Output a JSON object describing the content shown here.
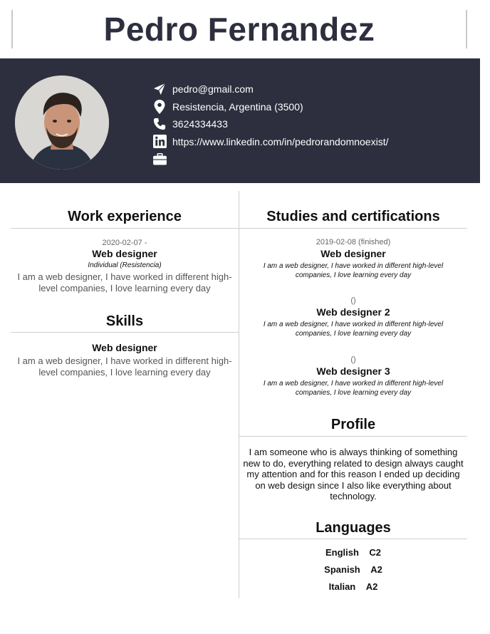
{
  "name": "Pedro Fernandez",
  "contact": {
    "email": "pedro@gmail.com",
    "location": "Resistencia, Argentina (3500)",
    "phone": "3624334433",
    "linkedin": "https://www.linkedin.com/in/pedrorandomnoexist/",
    "portfolio": ""
  },
  "icons": {
    "email": "paper-plane-icon",
    "location": "map-pin-icon",
    "phone": "phone-icon",
    "linkedin": "linkedin-icon",
    "portfolio": "briefcase-icon"
  },
  "colors": {
    "banner": "#2e2f3e",
    "title": "#2e2f3e"
  },
  "work": {
    "title": "Work experience",
    "entries": [
      {
        "date": "2020-02-07 -",
        "role": "Web designer",
        "place": "Individual (Resistencia)",
        "desc": "I am a web designer, I have worked in different high-level companies, I love learning every day"
      }
    ]
  },
  "skills": {
    "title": "Skills",
    "entries": [
      {
        "name": "Web designer",
        "desc": "I am a web designer, I have worked in different high-level companies, I love learning every day"
      }
    ]
  },
  "studies": {
    "title": "Studies and certifications",
    "entries": [
      {
        "date": "2019-02-08 (finished)",
        "name": "Web designer",
        "desc": "I am a web designer, I have worked in different high-level companies, I love learning every day"
      },
      {
        "date": "()",
        "name": "Web designer 2",
        "desc": "I am a web designer, I have worked in different high-level companies, I love learning every day"
      },
      {
        "date": "()",
        "name": "Web designer 3",
        "desc": "I am a web designer, I have worked in different high-level companies, I love learning every day"
      }
    ]
  },
  "profile": {
    "title": "Profile",
    "text": "I am someone who is always thinking of something new to do, everything related to design always caught my attention and for this reason I ended up deciding on web design since I also like everything about technology."
  },
  "languages": {
    "title": "Languages",
    "items": [
      {
        "name": "English",
        "level": "C2"
      },
      {
        "name": "Spanish",
        "level": "A2"
      },
      {
        "name": "Italian",
        "level": "A2"
      }
    ]
  }
}
